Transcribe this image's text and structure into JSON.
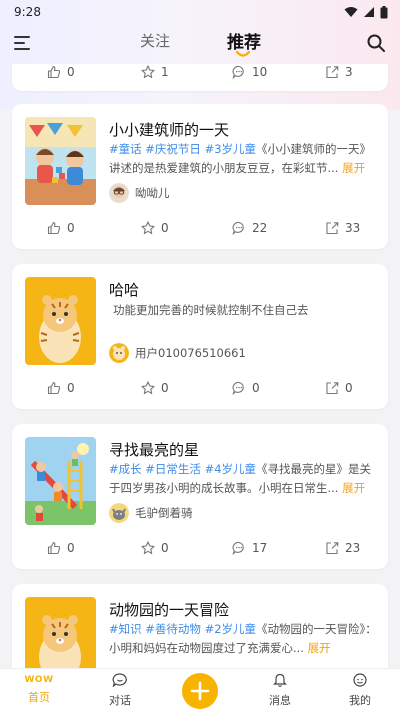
{
  "status": {
    "time": "9:28"
  },
  "nav": {
    "follow": "关注",
    "recommend": "推荐"
  },
  "partial_card": {
    "likes": "0",
    "stars": "1",
    "comments": "10",
    "shares": "3"
  },
  "cards": [
    {
      "title": "小小建筑师的一天",
      "tags": [
        "#童话",
        "#庆祝节日",
        "#3岁儿童"
      ],
      "desc": "《小小建筑师的一天》讲述的是热爱建筑的小朋友豆豆，在彩虹节...",
      "more": "展开",
      "author": "呦呦儿",
      "likes": "0",
      "stars": "0",
      "comments": "22",
      "shares": "33"
    },
    {
      "title": "哈哈",
      "desc": "功能更加完善的时候就控制不住自己去",
      "author": "用户010076510661",
      "likes": "0",
      "stars": "0",
      "comments": "0",
      "shares": "0"
    },
    {
      "title": "寻找最亮的星",
      "tags": [
        "#成长",
        "#日常生活",
        "#4岁儿童"
      ],
      "desc": "《寻找最亮的星》是关于四岁男孩小明的成长故事。小明在日常生...",
      "more": "展开",
      "author": "毛驴倒着骑",
      "likes": "0",
      "stars": "0",
      "comments": "17",
      "shares": "23"
    },
    {
      "title": "动物园的一天冒险",
      "tags": [
        "#知识",
        "#善待动物",
        "#2岁儿童"
      ],
      "desc": "《动物园的一天冒险》：小明和妈妈在动物园度过了充满爱心...",
      "more": "展开"
    }
  ],
  "bottom": {
    "logo": "WOW",
    "home": "首页",
    "chat": "对话",
    "msg": "消息",
    "mine": "我的"
  },
  "colors": {
    "accent": "#f6b400",
    "tag": "#3d8ce8",
    "more": "#f3a514"
  }
}
